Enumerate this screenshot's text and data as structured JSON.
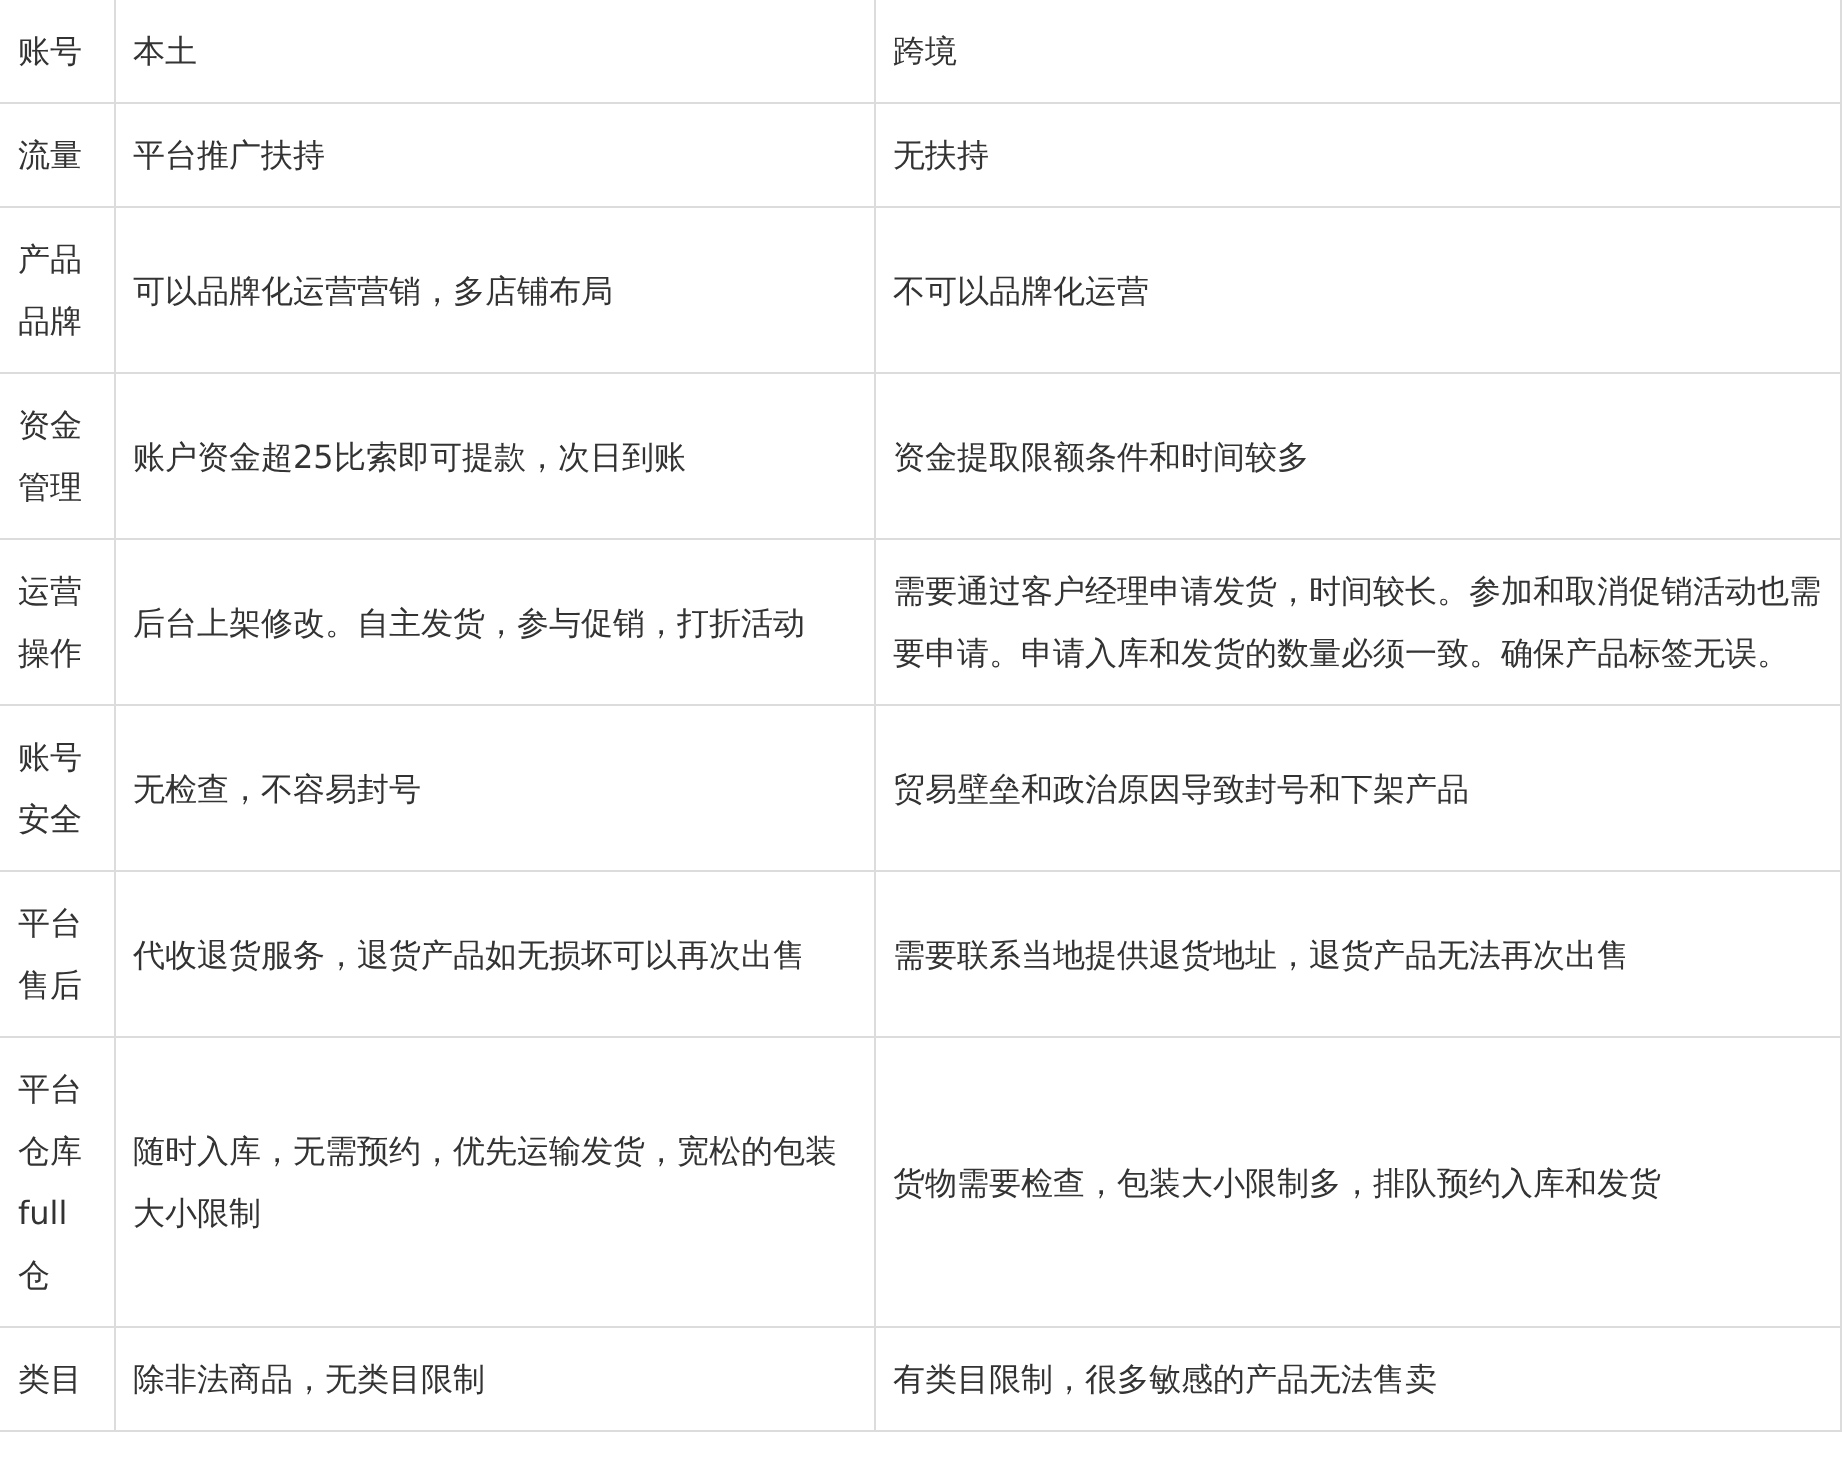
{
  "table": {
    "rows": [
      {
        "cells": [
          "账号",
          "本土",
          "跨境"
        ]
      },
      {
        "cells": [
          "流量",
          "平台推广扶持",
          "无扶持"
        ]
      },
      {
        "cells": [
          "产品品牌",
          "可以品牌化运营营销，多店铺布局",
          "不可以品牌化运营"
        ]
      },
      {
        "cells": [
          "资金管理",
          "账户资金超25比索即可提款，次日到账",
          "资金提取限额条件和时间较多"
        ]
      },
      {
        "cells": [
          "运营操作",
          "后台上架修改。自主发货，参与促销，打折活动",
          "需要通过客户经理申请发货，时间较长。参加和取消促销活动也需要申请。申请入库和发货的数量必须一致。确保产品标签无误。"
        ]
      },
      {
        "cells": [
          "账号安全",
          "无检查，不容易封号",
          "贸易壁垒和政治原因导致封号和下架产品"
        ]
      },
      {
        "cells": [
          "平台售后",
          "代收退货服务，退货产品如无损坏可以再次出售",
          "需要联系当地提供退货地址，退货产品无法再次出售"
        ]
      },
      {
        "cells": [
          "平台仓库full仓",
          "随时入库，无需预约，优先运输发货，宽松的包装大小限制",
          "货物需要检查，包装大小限制多，排队预约入库和发货"
        ]
      },
      {
        "cells": [
          "类目",
          "除非法商品，无类目限制",
          "有类目限制，很多敏感的产品无法售卖"
        ]
      }
    ]
  }
}
